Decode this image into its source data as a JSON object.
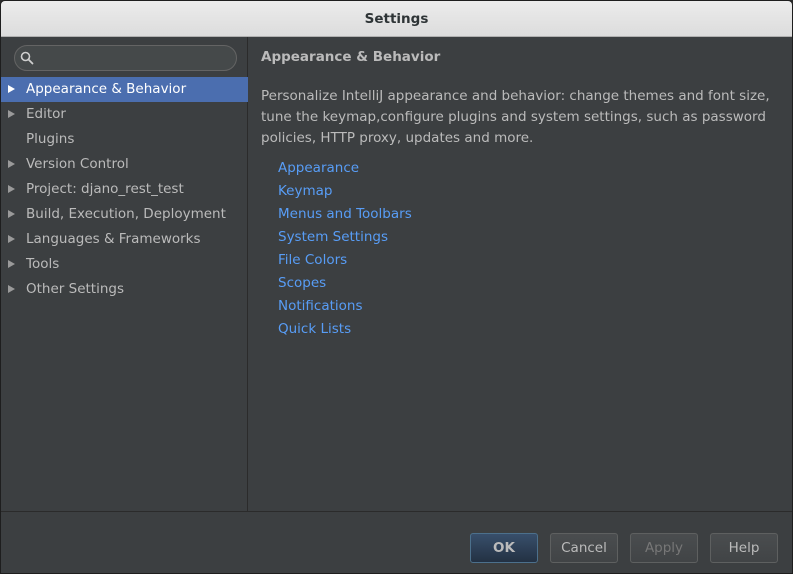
{
  "window": {
    "title": "Settings"
  },
  "search": {
    "placeholder": "",
    "value": ""
  },
  "sidebar": {
    "items": [
      {
        "label": "Appearance & Behavior",
        "expandable": true,
        "selected": true
      },
      {
        "label": "Editor",
        "expandable": true,
        "selected": false
      },
      {
        "label": "Plugins",
        "expandable": false,
        "selected": false
      },
      {
        "label": "Version Control",
        "expandable": true,
        "selected": false
      },
      {
        "label": "Project: djano_rest_test",
        "expandable": true,
        "selected": false
      },
      {
        "label": "Build, Execution, Deployment",
        "expandable": true,
        "selected": false
      },
      {
        "label": "Languages & Frameworks",
        "expandable": true,
        "selected": false
      },
      {
        "label": "Tools",
        "expandable": true,
        "selected": false
      },
      {
        "label": "Other Settings",
        "expandable": true,
        "selected": false
      }
    ]
  },
  "main": {
    "title": "Appearance & Behavior",
    "description_lines": [
      "Personalize IntelliJ appearance and behavior: change themes and font size,",
      "tune the keymap,configure plugins and system settings, such as password",
      "policies, HTTP proxy, updates and more."
    ],
    "links": [
      "Appearance",
      "Keymap",
      "Menus and Toolbars",
      "System Settings",
      "File Colors",
      "Scopes",
      "Notifications",
      "Quick Lists"
    ]
  },
  "footer": {
    "ok_label": "OK",
    "cancel_label": "Cancel",
    "apply_label": "Apply",
    "help_label": "Help"
  },
  "colors": {
    "selection": "#4b6eaf",
    "link": "#589df6",
    "background": "#3c3f41"
  }
}
